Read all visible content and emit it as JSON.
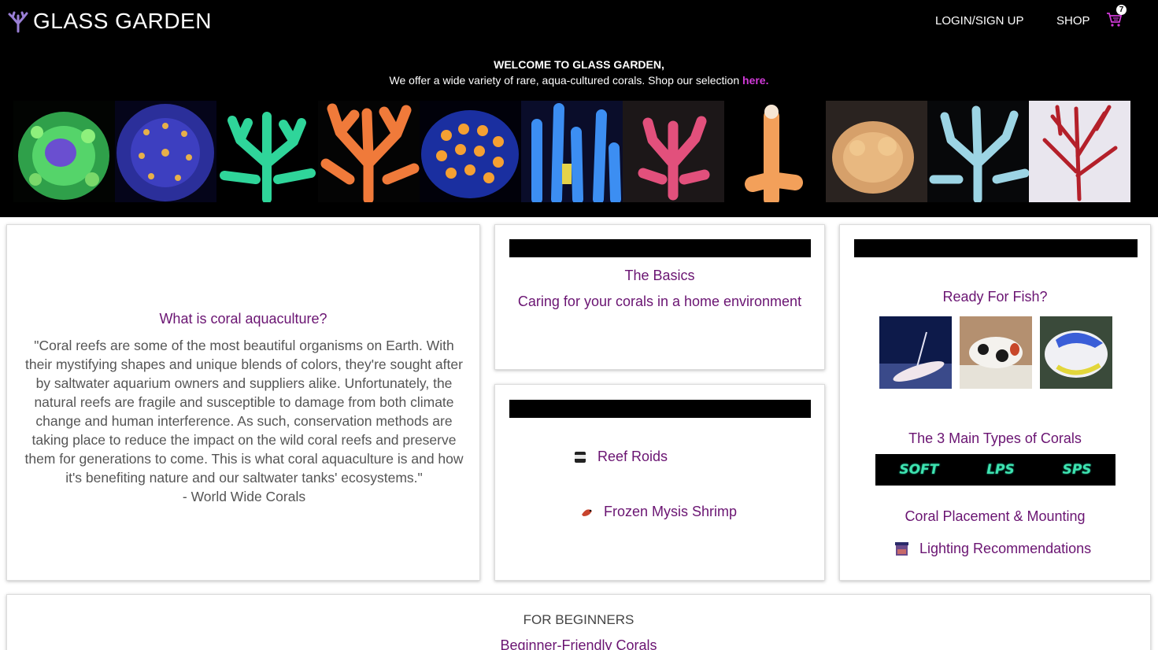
{
  "header": {
    "brand": "GLASS GARDEN",
    "nav": {
      "login": "LOGIN/SIGN UP",
      "shop": "SHOP"
    },
    "cart_count": "7"
  },
  "welcome": {
    "title": "WELCOME TO GLASS GARDEN,",
    "subtitle": "We offer a wide variety of rare, aqua-cultured corals. Shop our selection ",
    "link": "here."
  },
  "aquaculture": {
    "title": "What is coral aquaculture?",
    "quote": "\"Coral reefs are some of the most beautiful organisms on Earth. With their mystifying shapes and unique blends of colors, they're sought after by saltwater aquarium owners and suppliers alike. Unfortunately, the natural reefs are fragile and susceptible to damage from both climate change and human interference. As such, conservation methods are taking place to reduce the impact on the wild coral reefs and preserve them for generations to come. This is what coral aquaculture is and how it's benefiting nature and our saltwater tanks' ecosystems.\"",
    "attribution": "- World Wide Corals"
  },
  "basics": {
    "title": "The Basics",
    "caring": "Caring for your corals in a home environment"
  },
  "food": {
    "items": [
      "Reef Roids",
      "Frozen Mysis Shrimp"
    ]
  },
  "fish": {
    "title": "Ready For Fish?"
  },
  "types": {
    "title": "The 3 Main Types of Corals",
    "items": [
      "SOFT",
      "LPS",
      "SPS"
    ]
  },
  "guides": {
    "placement": "Coral Placement & Mounting",
    "lighting": "Lighting Recommendations"
  },
  "beginners": {
    "label": "FOR BEGINNERS",
    "link": "Beginner-Friendly Corals"
  },
  "colors": {
    "accent_purple": "#6a1472",
    "link_pink": "#d13ad8",
    "type_teal": "#3fe3b0"
  }
}
